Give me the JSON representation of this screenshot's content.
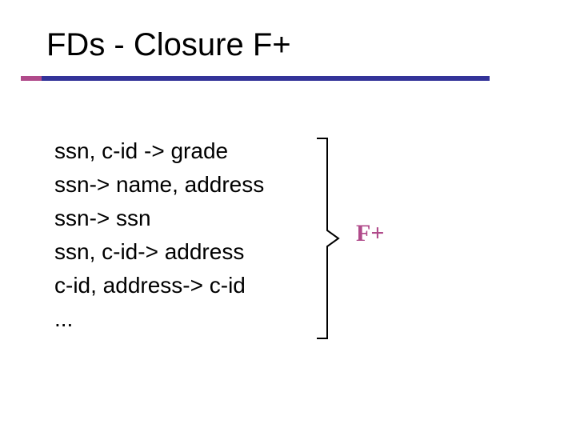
{
  "title": "FDs - Closure F+",
  "lines": [
    "ssn, c-id -> grade",
    "ssn-> name, address",
    "ssn-> ssn",
    "ssn, c-id-> address",
    "c-id, address-> c-id",
    "..."
  ],
  "label": "F+",
  "colors": {
    "accent": "#b04a8a",
    "bar": "#333399"
  }
}
